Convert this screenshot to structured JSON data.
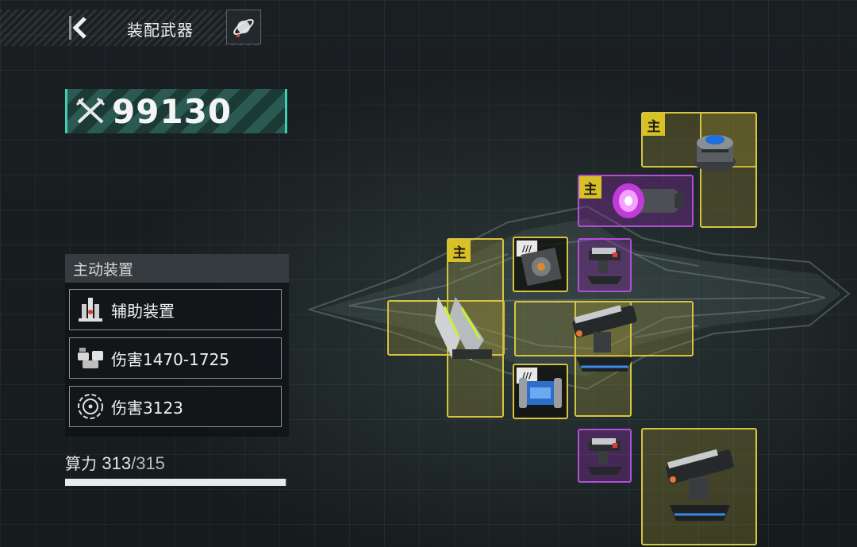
{
  "header": {
    "title": "装配武器",
    "back_icon": "chevron-left-icon",
    "planet_icon": "planet-icon"
  },
  "power": {
    "value": "99130",
    "icon": "crossed-swords-icon"
  },
  "active_panel": {
    "title": "主动装置",
    "slots": [
      {
        "icon": "assist-device-icon",
        "label": "辅助装置"
      },
      {
        "icon": "turret-cluster-icon",
        "label": "伤害1470-1725"
      },
      {
        "icon": "target-ring-icon",
        "label": "伤害3123"
      }
    ]
  },
  "compute": {
    "label": "算力",
    "used": "313",
    "slash": "/",
    "max": "315",
    "fraction": 0.994
  },
  "modules": {
    "main_badge": "主",
    "chip_label": "///"
  },
  "colors": {
    "accent_teal": "#3fd0b4",
    "slot_yellow": "#d6c441",
    "slot_purple": "#b24fd6",
    "badge_yellow": "#d8c127"
  }
}
